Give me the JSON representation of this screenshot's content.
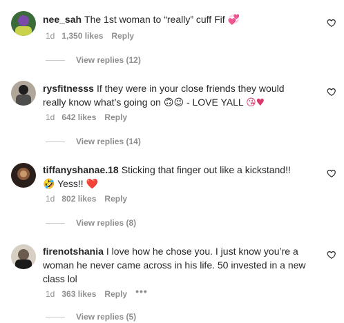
{
  "comments": [
    {
      "username": "nee_sah",
      "text": "The 1st woman to “really” cuff Fif",
      "emoji": "💞",
      "time": "1d",
      "likes": "1,350 likes",
      "reply": "Reply",
      "view_replies": "View replies (12)",
      "avatar_colors": [
        "#3c6b3a",
        "#7a4aa8",
        "#c8d24a"
      ]
    },
    {
      "username": "rysfitnesss",
      "text": "If they were in your close friends they would really know what’s going on",
      "emoji_mid": "🙃😉",
      "text2": "- LOVE YALL",
      "emoji_end": "😘♥",
      "time": "1d",
      "likes": "642 likes",
      "reply": "Reply",
      "view_replies": "View replies (14)",
      "avatar_colors": [
        "#1e1e1e",
        "#4d4d4d",
        "#b0a69a"
      ]
    },
    {
      "username": "tiffanyshanae.18",
      "text": "Sticking that finger out like a kickstand!!",
      "emoji_start": "🤣",
      "text2": "Yess!!",
      "emoji_end": "❤️",
      "time": "1d",
      "likes": "802 likes",
      "reply": "Reply",
      "view_replies": "View replies (8)",
      "avatar_colors": [
        "#2a1f1a",
        "#8a5a3c",
        "#c99a6e"
      ]
    },
    {
      "username": "firenotshania",
      "text": "I love how he chose you. I just know you’re a woman he never came across in his life. 50 invested in a new class lol",
      "time": "1d",
      "likes": "363 likes",
      "reply": "Reply",
      "more": "•••",
      "view_replies": "View replies (5)",
      "avatar_colors": [
        "#1a1a1a",
        "#6b5a4e",
        "#d8cfc4"
      ]
    }
  ],
  "icons": {
    "heart": "heart-outline-icon"
  }
}
